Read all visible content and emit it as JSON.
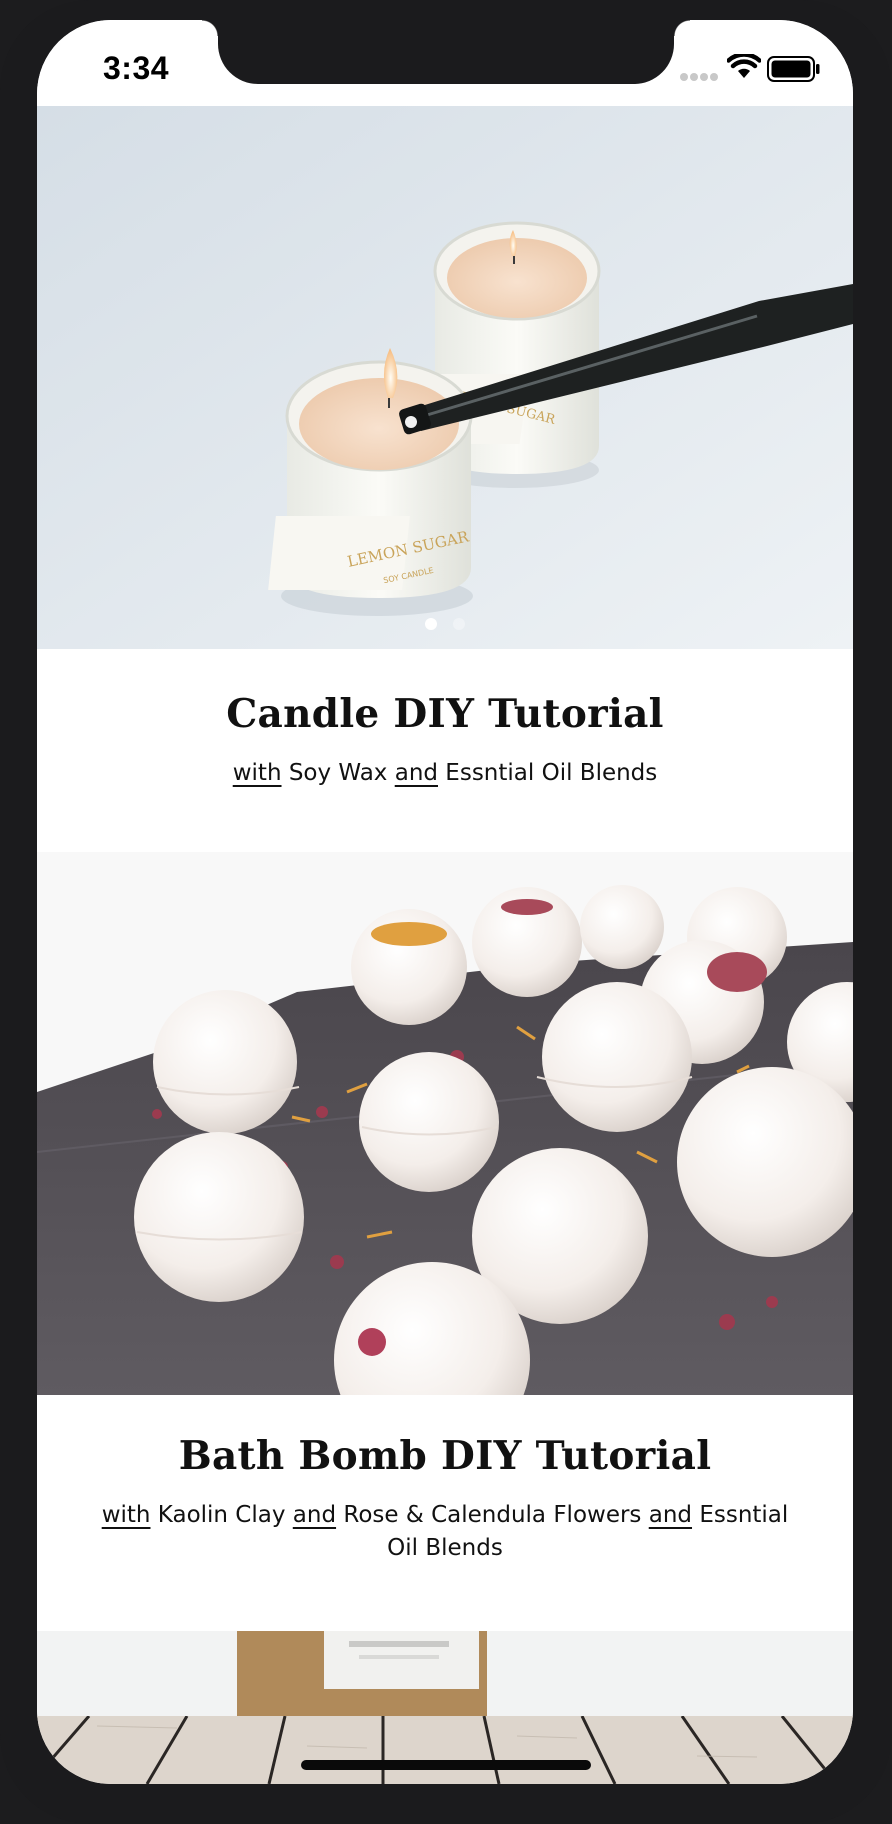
{
  "status_bar": {
    "time": "3:34"
  },
  "tutorials": [
    {
      "title": "Candle DIY Tutorial",
      "subtitle_parts": [
        "with",
        " Soy Wax ",
        "and",
        " Essntial Oil Blends"
      ],
      "image_icon": "candle-photo",
      "jar_label": "LEMON SUGAR",
      "jar_sublabel": "SOY CANDLE",
      "carousel_pages": 2,
      "carousel_active": 0
    },
    {
      "title": "Bath Bomb DIY Tutorial",
      "subtitle_parts": [
        "with",
        " Kaolin Clay ",
        "and",
        " Rose & Calendula Flowers ",
        "and",
        " Essntial Oil Blends"
      ],
      "image_icon": "bath-bomb-photo"
    },
    {
      "image_icon": "product-box-photo"
    }
  ],
  "colors": {
    "background": "#ffffff",
    "text": "#111111",
    "device_frame": "#1b1b1d"
  }
}
